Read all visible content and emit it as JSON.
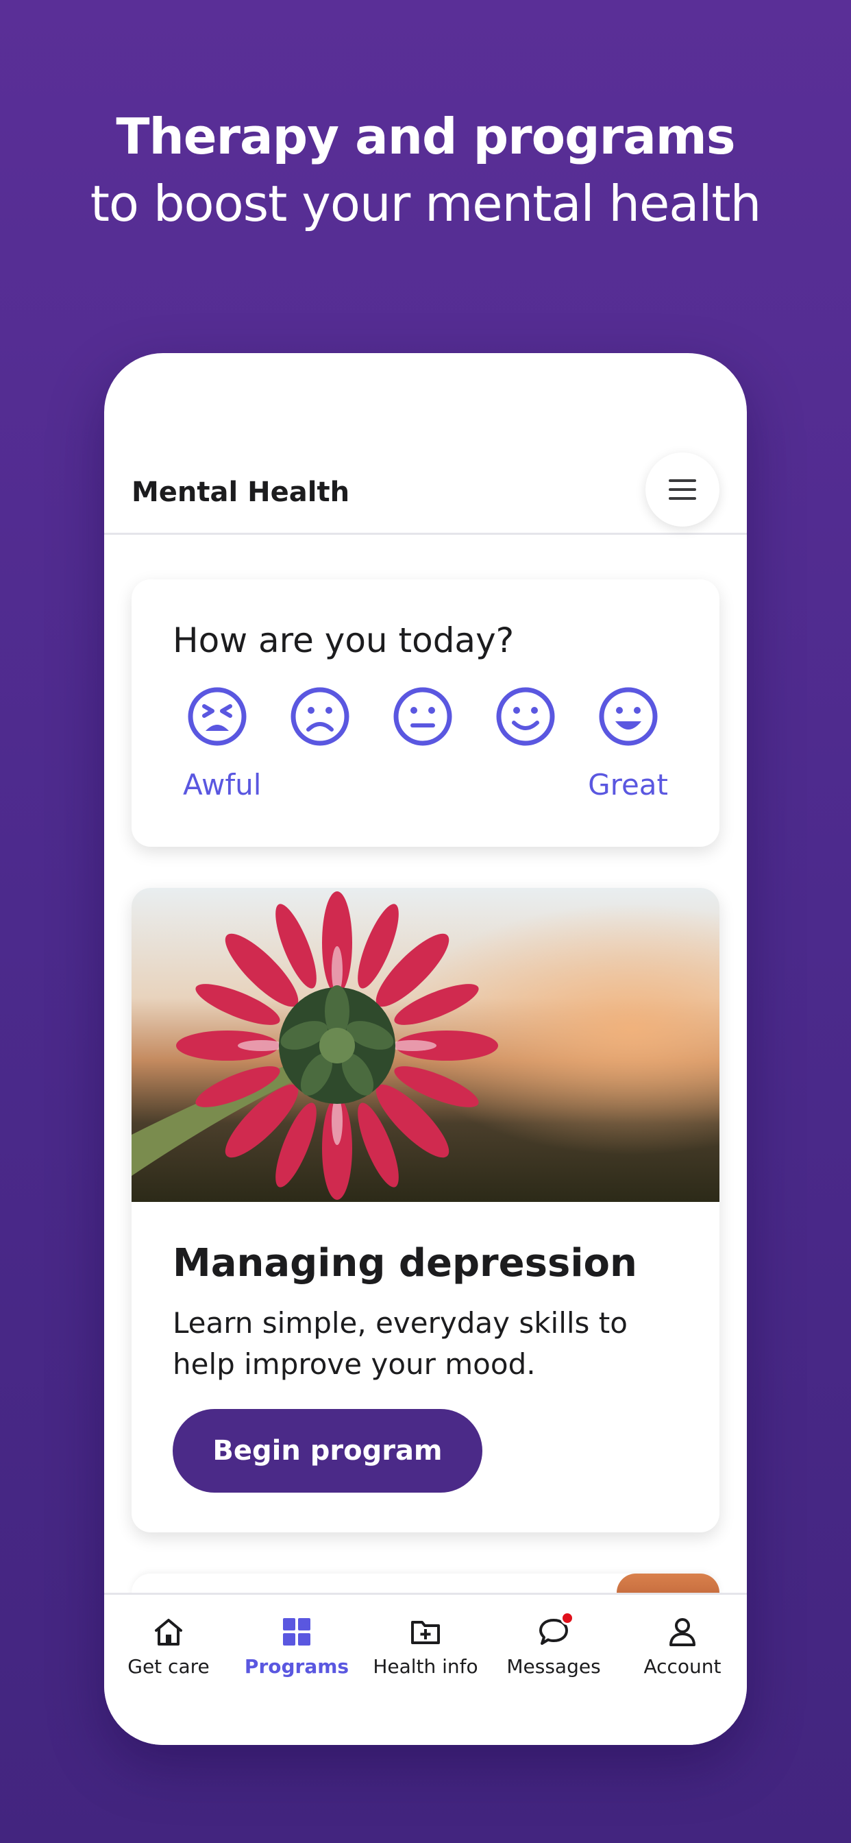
{
  "hero": {
    "title": "Therapy and programs",
    "subtitle": "to boost your mental health"
  },
  "header": {
    "title": "Mental Health",
    "menu_icon": "hamburger-menu-icon"
  },
  "mood": {
    "question": "How are you today?",
    "faces": [
      "tired-face-icon",
      "frowning-face-icon",
      "neutral-face-icon",
      "slightly-smiling-face-icon",
      "grinning-face-icon"
    ],
    "low_label": "Awful",
    "high_label": "Great",
    "accent": "#5a57e0"
  },
  "program": {
    "image": "pink-daisy-photo",
    "title": "Managing depression",
    "description": "Learn simple, everyday skills to help improve your mood.",
    "button": "Begin program",
    "button_color": "#4b2a88"
  },
  "tabs": [
    {
      "label": "Get care",
      "icon": "home-icon",
      "active": false
    },
    {
      "label": "Programs",
      "icon": "grid-icon",
      "active": true
    },
    {
      "label": "Health info",
      "icon": "folder-plus-icon",
      "active": false
    },
    {
      "label": "Messages",
      "icon": "chat-bubble-icon",
      "active": false,
      "badge": true
    },
    {
      "label": "Account",
      "icon": "person-icon",
      "active": false
    }
  ],
  "colors": {
    "background": "#5a2f97",
    "accent": "#5a57e0",
    "badge": "#e0101b"
  }
}
